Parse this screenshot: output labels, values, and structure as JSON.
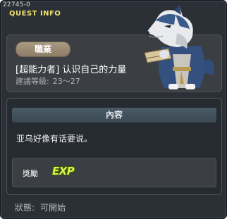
{
  "quest": {
    "id": "22745-0",
    "window_title": "QUEST INFO",
    "job_badge": "職業",
    "name": "[超能力者] 认识自己的力量",
    "level_label": "建議等級:",
    "level_range": "23～27",
    "content_header": "內容",
    "content_text": "亚乌好像有话要说。",
    "reward_label": "獎勵",
    "reward_icon": "EXP",
    "status_label": "狀態:",
    "status_value": "可開始"
  },
  "npc": {
    "icon": "wolf-npc-icon"
  },
  "colors": {
    "title": "#f2e26c",
    "panel": "#3b3e42",
    "header": "#4a5a66",
    "exp": "#d7f54a"
  }
}
